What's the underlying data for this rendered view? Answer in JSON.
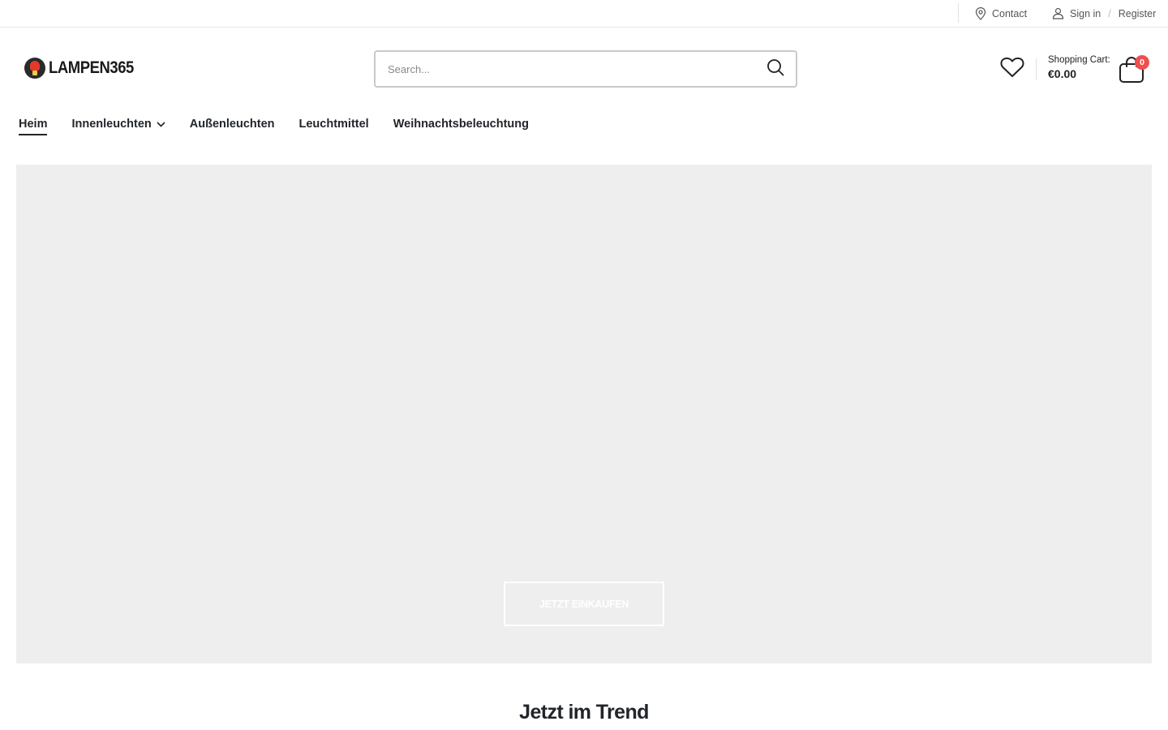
{
  "topbar": {
    "contact_label": "Contact",
    "signin_label": "Sign in",
    "separator": "/",
    "register_label": "Register"
  },
  "header": {
    "logo_text": "LAMPEN365",
    "search": {
      "placeholder": "Search..."
    },
    "cart": {
      "label": "Shopping Cart:",
      "amount": "€0.00",
      "count": "0"
    }
  },
  "nav": {
    "items": [
      {
        "label": "Heim",
        "active": true
      },
      {
        "label": "Innenleuchten",
        "has_dropdown": true
      },
      {
        "label": "Außenleuchten"
      },
      {
        "label": "Leuchtmittel"
      },
      {
        "label": "Weihnachtsbeleuchtung"
      }
    ]
  },
  "hero": {
    "cta_label": "JETZT EINKAUFEN"
  },
  "sections": {
    "trending_title": "Jetzt im Trend"
  },
  "colors": {
    "accent": "#222529",
    "badge": "#ef4f4f",
    "hero_bg": "#eeeeee"
  }
}
